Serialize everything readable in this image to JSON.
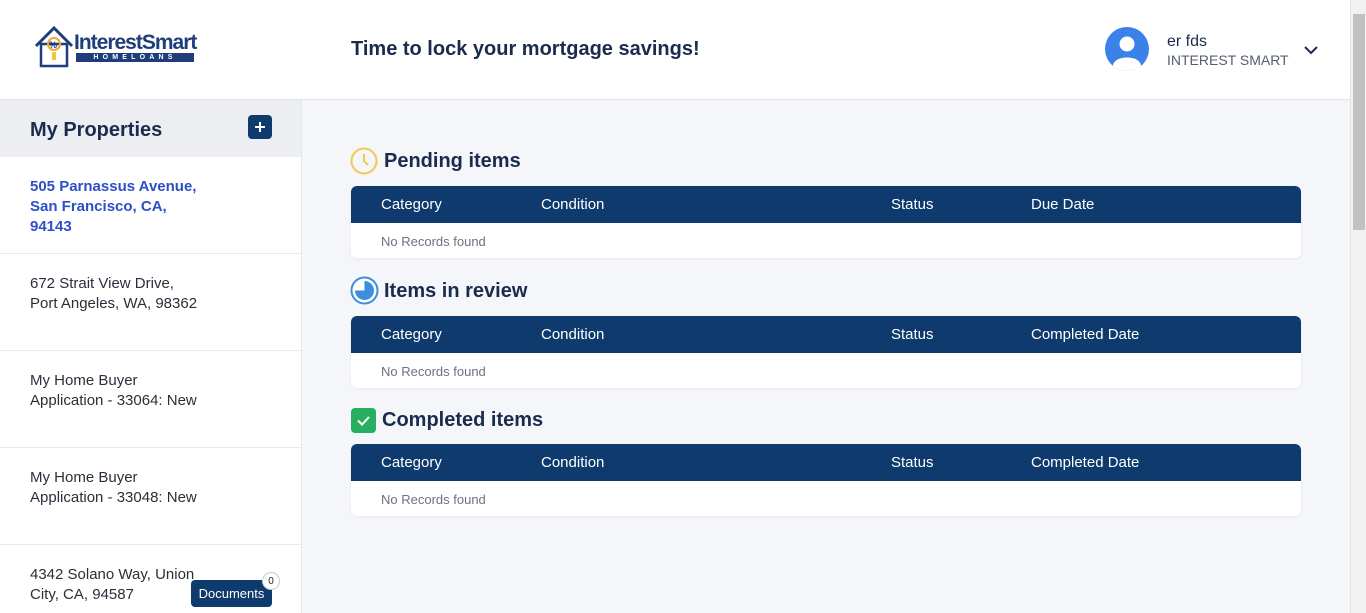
{
  "header": {
    "logo_text": "InterestSmart",
    "logo_tagline": "HOMELOANS",
    "title": "Time to lock your mortgage savings!",
    "user_name": "er fds",
    "user_org": "INTEREST SMART"
  },
  "sidebar": {
    "title": "My Properties",
    "properties": [
      {
        "label": "505 Parnassus Avenue, San Francisco, CA, 94143"
      },
      {
        "label": "672 Strait View Drive, Port Angeles, WA, 98362"
      },
      {
        "label": "My Home Buyer Application - 33064: New"
      },
      {
        "label": "My Home Buyer Application - 33048: New"
      },
      {
        "label": "4342 Solano Way, Union City, CA, 94587"
      }
    ],
    "documents_label": "Documents",
    "documents_count": "0"
  },
  "sections": {
    "pending": {
      "title": "Pending items",
      "columns": [
        "Category",
        "Condition",
        "Status",
        "Due Date"
      ],
      "empty": "No Records found"
    },
    "review": {
      "title": "Items in review",
      "columns": [
        "Category",
        "Condition",
        "Status",
        "Completed Date"
      ],
      "empty": "No Records found"
    },
    "completed": {
      "title": "Completed items",
      "columns": [
        "Category",
        "Condition",
        "Status",
        "Completed Date"
      ],
      "empty": "No Records found"
    }
  },
  "colors": {
    "navy": "#0e3a6e",
    "link_blue": "#2d4fc8",
    "pending_yellow": "#f2c94c",
    "review_blue": "#3b8ede",
    "completed_green": "#27ae60"
  }
}
